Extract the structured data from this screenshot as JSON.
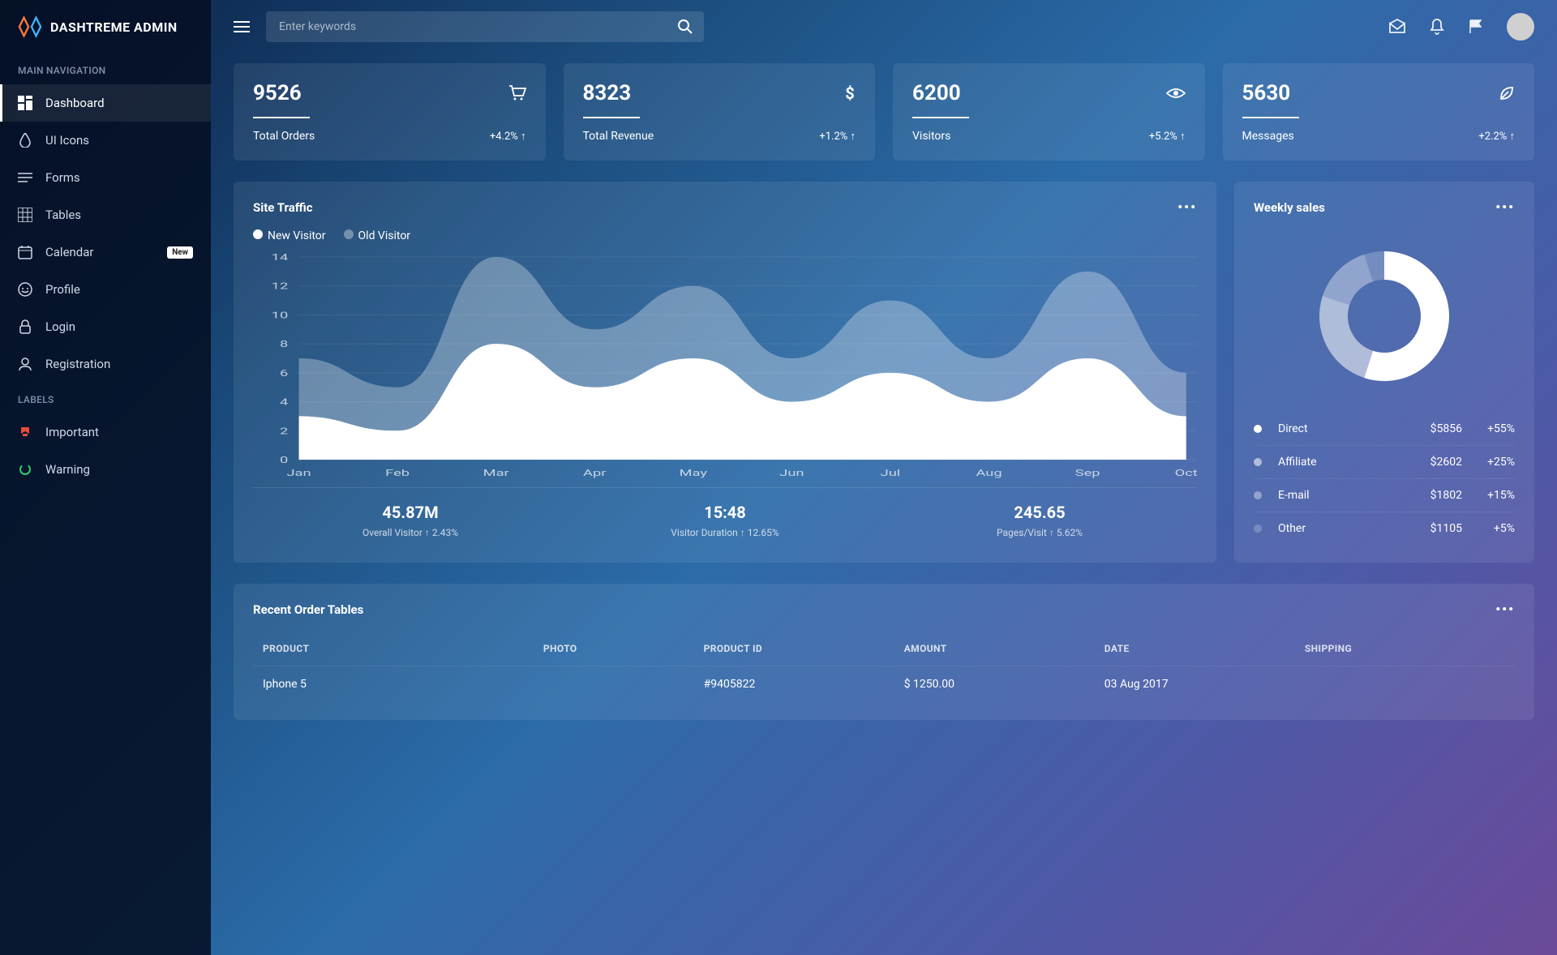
{
  "brand": {
    "text": "DASHTREME ADMIN"
  },
  "search": {
    "placeholder": "Enter keywords"
  },
  "sidebar": {
    "header_main": "MAIN NAVIGATION",
    "header_labels": "LABELS",
    "items": [
      {
        "label": "Dashboard"
      },
      {
        "label": "UI Icons"
      },
      {
        "label": "Forms"
      },
      {
        "label": "Tables"
      },
      {
        "label": "Calendar",
        "badge": "New"
      },
      {
        "label": "Profile"
      },
      {
        "label": "Login"
      },
      {
        "label": "Registration"
      }
    ],
    "labels": [
      {
        "label": "Important",
        "color": "#e74c3c"
      },
      {
        "label": "Warning",
        "color": "#2ecc71"
      }
    ]
  },
  "stats": [
    {
      "value": "9526",
      "label": "Total Orders",
      "change": "+4.2% ↑",
      "icon": "cart-icon"
    },
    {
      "value": "8323",
      "label": "Total Revenue",
      "change": "+1.2% ↑",
      "icon": "dollar-icon"
    },
    {
      "value": "6200",
      "label": "Visitors",
      "change": "+5.2% ↑",
      "icon": "eye-icon"
    },
    {
      "value": "5630",
      "label": "Messages",
      "change": "+2.2% ↑",
      "icon": "leaf-icon"
    }
  ],
  "traffic": {
    "title": "Site Traffic",
    "legend": [
      {
        "label": "New Visitor",
        "color": "#ffffff"
      },
      {
        "label": "Old Visitor",
        "color": "rgba(255,255,255,0.35)"
      }
    ],
    "footer": [
      {
        "value": "45.87M",
        "label": "Overall Visitor ↑ 2.43%"
      },
      {
        "value": "15:48",
        "label": "Visitor Duration ↑ 12.65%"
      },
      {
        "value": "245.65",
        "label": "Pages/Visit ↑ 5.62%"
      }
    ]
  },
  "weekly": {
    "title": "Weekly sales",
    "rows": [
      {
        "label": "Direct",
        "amount": "$5856",
        "pct": "+55%",
        "color": "#ffffff"
      },
      {
        "label": "Affiliate",
        "amount": "$2602",
        "pct": "+25%",
        "color": "rgba(255,255,255,0.55)"
      },
      {
        "label": "E-mail",
        "amount": "$1802",
        "pct": "+15%",
        "color": "rgba(255,255,255,0.38)"
      },
      {
        "label": "Other",
        "amount": "$1105",
        "pct": "+5%",
        "color": "rgba(255,255,255,0.22)"
      }
    ]
  },
  "orders": {
    "title": "Recent Order Tables",
    "columns": [
      "PRODUCT",
      "PHOTO",
      "PRODUCT ID",
      "AMOUNT",
      "DATE",
      "SHIPPING"
    ],
    "rows": [
      {
        "product": "Iphone 5",
        "product_id": "#9405822",
        "amount": "$ 1250.00",
        "date": "03 Aug 2017",
        "shipping": ""
      }
    ]
  },
  "chart_data": [
    {
      "type": "area",
      "title": "Site Traffic",
      "xlabel": "",
      "ylabel": "",
      "ylim": [
        0,
        14
      ],
      "categories": [
        "Jan",
        "Feb",
        "Mar",
        "Apr",
        "May",
        "Jun",
        "Jul",
        "Aug",
        "Sep",
        "Oct"
      ],
      "series": [
        {
          "name": "New Visitor",
          "values": [
            3,
            2,
            8,
            5,
            7,
            4,
            6,
            4,
            7,
            3
          ]
        },
        {
          "name": "Old Visitor",
          "values": [
            7,
            5,
            14,
            9,
            12,
            7,
            11,
            7,
            13,
            6
          ]
        }
      ]
    },
    {
      "type": "pie",
      "title": "Weekly sales",
      "categories": [
        "Direct",
        "Affiliate",
        "E-mail",
        "Other"
      ],
      "values": [
        55,
        25,
        15,
        5
      ]
    }
  ]
}
